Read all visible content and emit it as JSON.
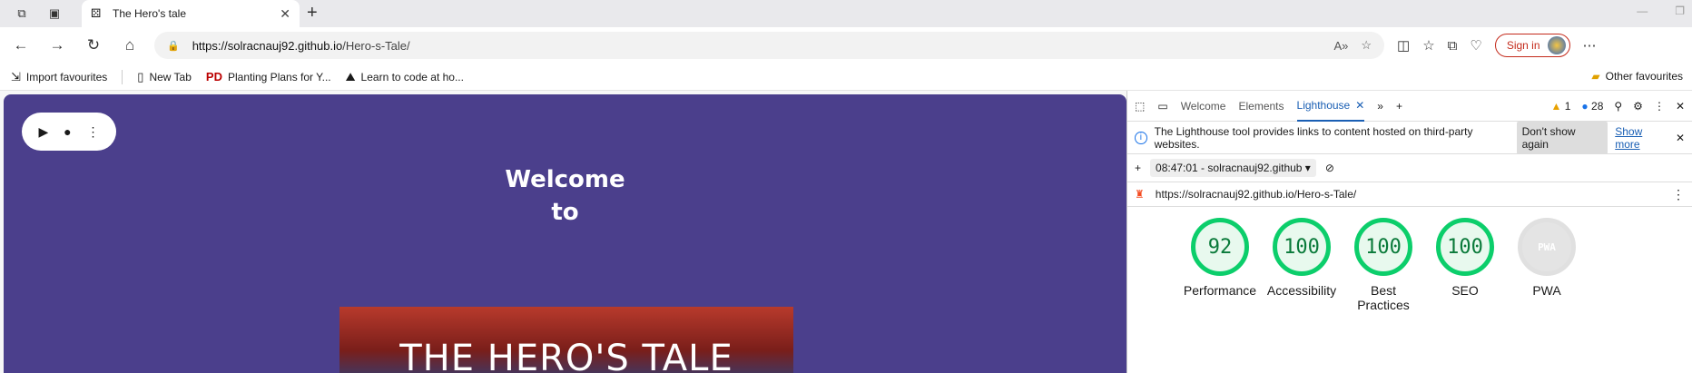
{
  "browser": {
    "tab_title": "The Hero's tale",
    "url_host": "https://solracnauj92.github.io",
    "url_path": "/Hero-s-Tale/",
    "signin": "Sign in"
  },
  "favourites": {
    "items": [
      "Import favourites",
      "New Tab",
      "Planting Plans for Y...",
      "Learn to code at ho..."
    ],
    "other": "Other favourites"
  },
  "page": {
    "welcome_line1": "Welcome",
    "welcome_line2": "to",
    "hero_title": "THE HERO'S TALE"
  },
  "devtools": {
    "tabs": [
      "Welcome",
      "Elements",
      "Lighthouse"
    ],
    "warnings": "1",
    "messages": "28",
    "info_text": "The Lighthouse tool provides links to content hosted on third-party websites.",
    "dont_show": "Don't show again",
    "show_more": "Show more",
    "report_select": "08:47:01 - solracnauj92.github",
    "report_url": "https://solracnauj92.github.io/Hero-s-Tale/",
    "gauges": [
      {
        "score": "92",
        "label": "Performance"
      },
      {
        "score": "100",
        "label": "Accessibility"
      },
      {
        "score": "100",
        "label": "Best Practices"
      },
      {
        "score": "100",
        "label": "SEO"
      },
      {
        "score": "PWA",
        "label": "PWA"
      }
    ]
  }
}
